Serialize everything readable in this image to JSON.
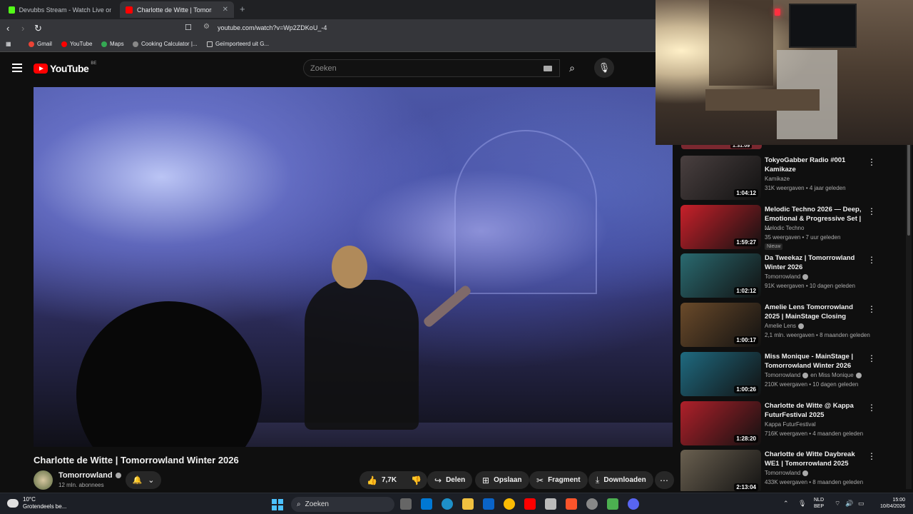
{
  "browser": {
    "tabs": [
      {
        "label": "Devubbs Stream - Watch Live on Kick",
        "icon": "kick-icon",
        "active": false
      },
      {
        "label": "Charlotte de Witte | Tomorrowl",
        "icon": "youtube-icon",
        "active": true
      }
    ],
    "new_tab": "+",
    "url": "youtube.com/watch?v=Wp2ZDKoU_-4",
    "bookmarks": [
      "Gmail",
      "YouTube",
      "Maps",
      "Cooking Calculator |...",
      "Geïmporteerd uit G..."
    ]
  },
  "youtube": {
    "logo_text": "YouTube",
    "region": "BE",
    "search_placeholder": "Zoeken"
  },
  "video": {
    "title": "Charlotte de Witte | Tomorrowland Winter 2026",
    "channel": "Tomorrowland",
    "subscribers": "12 mln. abonnees",
    "likes": "7,7K",
    "actions": {
      "share": "Delen",
      "save": "Opslaan",
      "clip": "Fragment",
      "download": "Downloaden"
    }
  },
  "sidebar": {
    "top_duration": "1:31:09",
    "items": [
      {
        "title": "TokyoGabber Radio #001 Kamikaze",
        "channel": "Kamikaze",
        "meta": "31K weergaven • 4 jaar geleden",
        "duration": "1:04:12",
        "color": "#4a4040",
        "verified": false,
        "badge": ""
      },
      {
        "title": "Melodic Techno 2026 — Deep, Emotional & Progressive Set | ...",
        "channel": "Melodic Techno",
        "meta": "35 weergaven • 7 uur geleden",
        "duration": "1:59:27",
        "color": "#c8202a",
        "verified": false,
        "badge": "Nieuw"
      },
      {
        "title": "Da Tweekaz | Tomorrowland Winter 2026",
        "channel": "Tomorrowland",
        "meta": "91K weergaven • 10 dagen geleden",
        "duration": "1:02:12",
        "color": "#2a6a70",
        "verified": true,
        "badge": ""
      },
      {
        "title": "Amelie Lens Tomorrowland 2025 | MainStage Closing",
        "channel": "Amelie Lens",
        "meta": "2,1 mln. weergaven • 8 maanden geleden",
        "duration": "1:00:17",
        "color": "#6a4a2a",
        "verified": true,
        "badge": ""
      },
      {
        "title": "Miss Monique - MainStage | Tomorrowland Winter 2026",
        "channel": "Tomorrowland",
        "channel_extra": "en Miss Monique",
        "meta": "210K weergaven • 10 dagen geleden",
        "duration": "1:00:26",
        "color": "#1f6a80",
        "verified": true,
        "badge": ""
      },
      {
        "title": "Charlotte de Witte @ Kappa FuturFestival 2025",
        "channel": "Kappa FuturFestival",
        "meta": "716K weergaven • 4 maanden geleden",
        "duration": "1:28:20",
        "color": "#b0202a",
        "verified": false,
        "badge": ""
      },
      {
        "title": "Charlotte de Witte Daybreak WE1 | Tomorrowland 2025",
        "channel": "Tomorrowland",
        "meta": "433K weergaven • 8 maanden geleden",
        "duration": "2:13:04",
        "color": "#6a6050",
        "verified": true,
        "badge": ""
      }
    ]
  },
  "taskbar": {
    "weather_temp": "10°C",
    "weather_desc": "Grotendeels be...",
    "search": "Zoeken",
    "lang_line1": "NLD",
    "lang_line2": "BEP",
    "time": "15:00",
    "date": "10/04/2026"
  }
}
